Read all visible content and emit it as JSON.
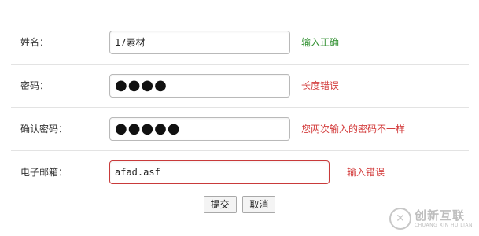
{
  "form": {
    "rows": [
      {
        "label": "姓名：",
        "value": "17素材",
        "message": "输入正确",
        "status": "ok"
      },
      {
        "label": "密码：",
        "value": "●●●●",
        "message": "长度错误",
        "status": "error"
      },
      {
        "label": "确认密码：",
        "value": "●●●●●",
        "message": "您两次输入的密码不一样",
        "status": "error"
      },
      {
        "label": "电子邮箱：",
        "value": "afad.asf",
        "message": "输入错误",
        "status": "error"
      }
    ],
    "submit_label": "提交",
    "cancel_label": "取消"
  },
  "watermark": {
    "symbol": "✕",
    "text_cn": "创新互联",
    "text_en": "CHUANG XIN HU LIAN"
  },
  "colors": {
    "ok": "#2f8f2f",
    "error": "#d33c3c",
    "border": "#b9b9b9",
    "error_border": "#c93a3a"
  }
}
